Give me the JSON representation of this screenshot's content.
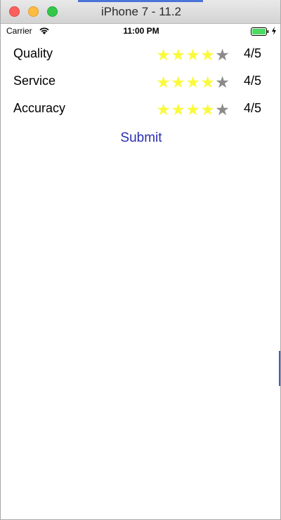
{
  "window": {
    "title": "iPhone 7 - 11.2"
  },
  "statusbar": {
    "carrier": "Carrier",
    "time": "11:00 PM",
    "battery_color": "#4cd964"
  },
  "ratings": [
    {
      "label": "Quality",
      "value_text": "4/5",
      "stars": 4,
      "max": 5
    },
    {
      "label": "Service",
      "value_text": "4/5",
      "stars": 4,
      "max": 5
    },
    {
      "label": "Accuracy",
      "value_text": "4/5",
      "stars": 4,
      "max": 5
    }
  ],
  "submit": {
    "label": "Submit"
  },
  "colors": {
    "star_on": "#fafa3c",
    "star_off": "#8a8a8a",
    "link": "#2b2fb0"
  }
}
